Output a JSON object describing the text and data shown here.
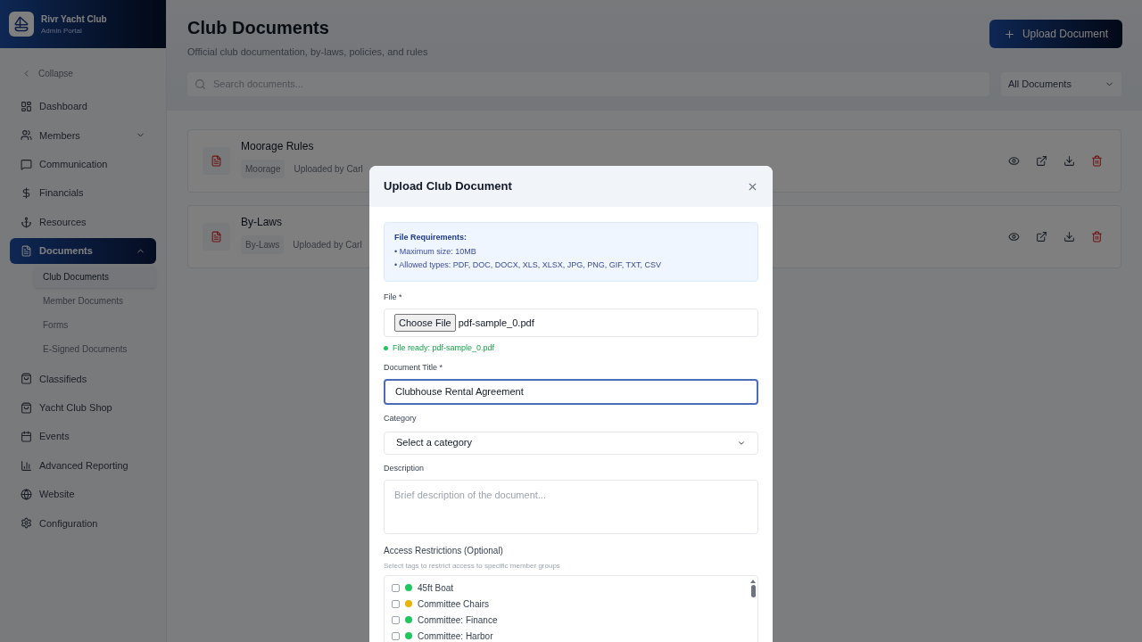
{
  "brand": {
    "name": "Rivr Yacht Club",
    "subtitle": "Admin Portal"
  },
  "sidebar": {
    "collapse": "Collapse",
    "items": [
      {
        "label": "Dashboard",
        "selected": false
      },
      {
        "label": "Members",
        "selected": false,
        "expanded": false
      },
      {
        "label": "Communication",
        "selected": false
      },
      {
        "label": "Financials",
        "selected": false
      },
      {
        "label": "Resources",
        "selected": false
      },
      {
        "label": "Documents",
        "selected": true,
        "expanded": true,
        "children": [
          {
            "label": "Club Documents",
            "selected": true
          },
          {
            "label": "Member Documents",
            "selected": false
          },
          {
            "label": "Forms",
            "selected": false
          },
          {
            "label": "E-Signed Documents",
            "selected": false
          }
        ]
      },
      {
        "label": "Classifieds",
        "selected": false
      },
      {
        "label": "Yacht Club Shop",
        "selected": false
      },
      {
        "label": "Events",
        "selected": false
      },
      {
        "label": "Advanced Reporting",
        "selected": false
      },
      {
        "label": "Website",
        "selected": false
      },
      {
        "label": "Configuration",
        "selected": false
      }
    ]
  },
  "page": {
    "title": "Club Documents",
    "subtitle": "Official club documentation, by-laws, policies, and rules",
    "upload_button": "Upload Document",
    "search": {
      "placeholder": "Search documents..."
    },
    "filter": "All Documents"
  },
  "documents": [
    {
      "title": "Moorage Rules",
      "category": "Moorage",
      "uploaded": "Uploaded by Carl"
    },
    {
      "title": "By-Laws",
      "category": "By-Laws",
      "uploaded": "Uploaded by Carl"
    }
  ],
  "modal": {
    "title": "Upload Club Document",
    "requirements": {
      "heading": "File Requirements:",
      "lines": [
        "• Maximum size: 10MB",
        "• Allowed types: PDF, DOC, DOCX, XLS, XLSX, JPG, PNG, GIF, TXT, CSV"
      ]
    },
    "file": {
      "label": "File *",
      "button": "Choose File",
      "value": "pdf-sample_0.pdf",
      "status": "File ready: pdf-sample_0.pdf"
    },
    "title_field": {
      "label": "Document Title *",
      "value": "Clubhouse Rental Agreement",
      "focused": true
    },
    "category": {
      "label": "Category",
      "value": "Select a category"
    },
    "description": {
      "label": "Description",
      "placeholder": "Brief description of the document..."
    },
    "access": {
      "label": "Access Restrictions (Optional)",
      "hint": "Select tags to restrict access to specific member groups",
      "tags": [
        {
          "label": "45ft Boat",
          "color": "#22c55e",
          "checked": false
        },
        {
          "label": "Committee Chairs",
          "color": "#eab308",
          "checked": false
        },
        {
          "label": "Committee: Finance",
          "color": "#22c55e",
          "checked": false
        },
        {
          "label": "Committee: Harbor",
          "color": "#22c55e",
          "checked": false
        }
      ]
    }
  }
}
